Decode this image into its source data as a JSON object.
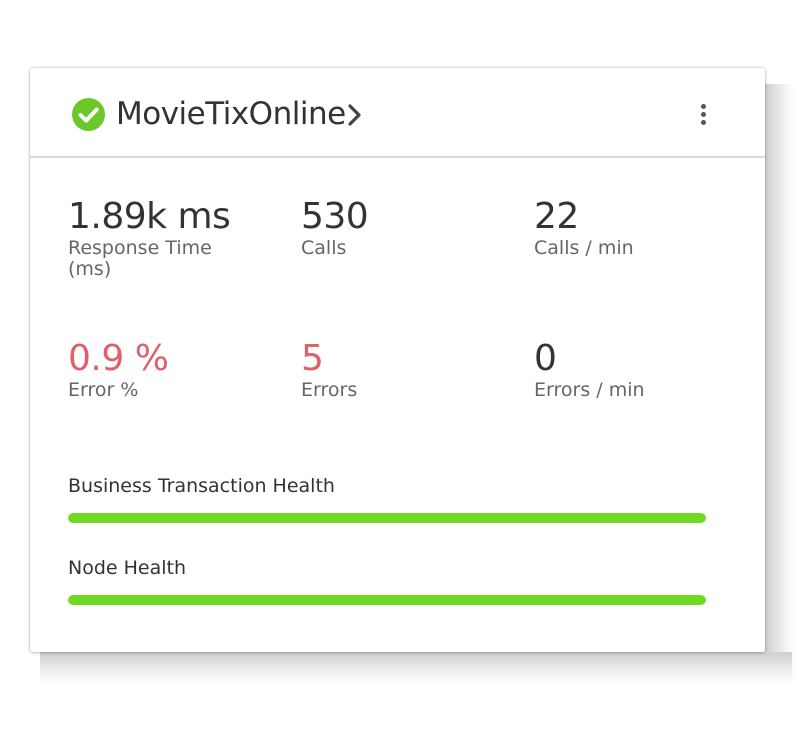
{
  "card": {
    "title": "MovieTixOnline",
    "status": "healthy",
    "status_color": "#6bc72a",
    "menu_icon": "kebab-menu-icon"
  },
  "metrics": [
    {
      "value": "1.89k ms",
      "label": "Response Time (ms)",
      "state": "normal"
    },
    {
      "value": "530",
      "label": "Calls",
      "state": "normal"
    },
    {
      "value": "22",
      "label": "Calls / min",
      "state": "normal"
    },
    {
      "value": "0.9 %",
      "label": "Error %",
      "state": "error"
    },
    {
      "value": "5",
      "label": "Errors",
      "state": "error"
    },
    {
      "value": "0",
      "label": "Errors / min",
      "state": "normal"
    }
  ],
  "health": [
    {
      "label": "Business Transaction Health",
      "fraction": 1.0,
      "color": "#6edb22"
    },
    {
      "label": "Node Health",
      "fraction": 1.0,
      "color": "#6edb22"
    }
  ],
  "colors": {
    "error": "#e0606a",
    "healthy": "#6edb22"
  }
}
